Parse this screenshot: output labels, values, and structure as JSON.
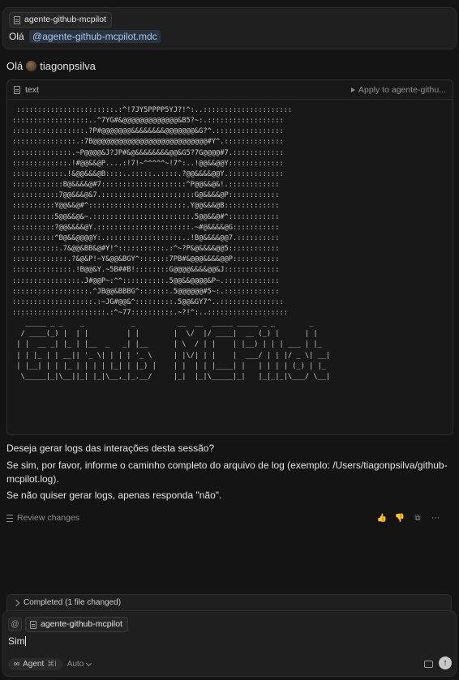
{
  "top_message": {
    "chip_label": "agente-github-mcpilot",
    "text": "Olá",
    "mention": "@agente-github-mcpilot.mdc"
  },
  "greeting": {
    "prefix": "Olá",
    "username": "tiagonpsilva"
  },
  "code_block": {
    "language": "text",
    "apply_label": "Apply to agente-githu...",
    "ascii_art": " :::::::::::::::::::::::.:^!7JY5PPPP5YJ?!^:..:::::::::::::::::::::\n::::::::::::::::::..^7YG#&@@@@@@@@@@@@@&B5?~:.::::::::::::::::::\n:::::::::::::::::.?P#@@@@@@@&&&&&&&&@@@@@@@&G?^.::::::::::::::::\n:::::::::::::::.:7B@@@@@@@@@@@@@@@@@@@@@@@@@@@#Y^.::::::::::::::\n::::::::::::::.~P@@@@&J?JP#&@&&&&&&&&@@&G5?7G@@@@#7.::::::::::::\n:::::::::::::.!#@@&&@P....:!7!~^^^^^~!7^:..!@@&&@@Y:::::::::::::\n::::::::::::.!&@@&&&@B::::..:::::..::::.?@@&&&&@@Y.:::::::::::::\n::::::::::::B@&&&&@#7::::::::::::::::::::^P@@&&@&!.::::::::::::\n:::::::::::7@@&&&@&7.::::::::::::::::::::::G@&&&&@P::::::::::::\n::::::::::Y@@&&@#^:::::::::::::::::::::::.Y@@&&&@B:::::::::::::\n::::::::::5@@&&@&~.:::::::::::::::::::::::.5@@&&@#^::::::::::::\n::::::::::?@@&&&&@Y.::::::::::::::::::::::.~#@&&&&@G:::::::::::\n::::::::::^B@&&@@@@Y:.::::::::::::::::::..!B@&&&&@@7.::::::::::\n:::::::::::.7&@@&BB&@#Y!^:::::::::::.:^~?P&@&&&&@@5::::::::::::\n:::::::::::::.?&@&P!~Y&@@&BGY^:::::::7PB#&@@@&&&&@@P:::::::::::\n::::::::::::::.!B@@&Y.~5B##B!::::::::G@@@@&&&&@@&J:::::::::::::\n::::::::::::::::.J#@@P~:^^::::::::::.5@@&&@@@@&P~.:::::::::::::\n::::::::::::::::::.^JB@@&BBBG^:::::::.5@@@@@@#5~:.:::::::::::::\n:::::::::::::::::::.:~JG#@@&^:::::::::.5@@&GY7^..:::::::::::::::\n::::::::::::::::::::::.:^~77::::::::::.~?!^:..:::::::::::::::::::\n   _____ _ _    _           _          __  __  _____ _____ _ _        _  \n  / ____(_) |  | |         | |        |  \\/  |/ ____|  __ (_) |      | | \n | |  __ _| |_ | |__  _   _| |__      | \\  / | |    | |__) | | | ___ | |_ \n | | |_ | | __|| '_ \\| | | | '_ \\     | |\\/| | |    |  ___/ | | |/ _ \\| __|\n | |__| | | |_ | | | | |_| | |_) |    | |  | | |____| |   | | | | (_) | |_ \n  \\_____|_|\\__||_| |_|\\__,_|_.__/     |_|  |_|\\_____|_|   |_|_|_|\\___/ \\__|"
  },
  "response": {
    "question": "Deseja gerar logs das interações desta sessão?",
    "instruction": "Se sim, por favor, informe o caminho completo do arquivo de log (exemplo: /Users/tiagonpsilva/github-mcpilot.log).",
    "decline": "Se não quiser gerar logs, apenas responda \"não\"."
  },
  "review_label": "Review changes",
  "completed_label": "Completed (1 file changed)",
  "composer": {
    "at_symbol": "@",
    "chip_label": "agente-github-mcpilot",
    "text": "Sim",
    "mode_label": "Agent",
    "mode_shortcut": "⌘I",
    "model_label": "Auto"
  },
  "icons": {
    "thumbs_up": "👍",
    "thumbs_down": "👎",
    "copy": "⧉",
    "more": "⋯",
    "send": "↑",
    "infinity": "∞"
  }
}
